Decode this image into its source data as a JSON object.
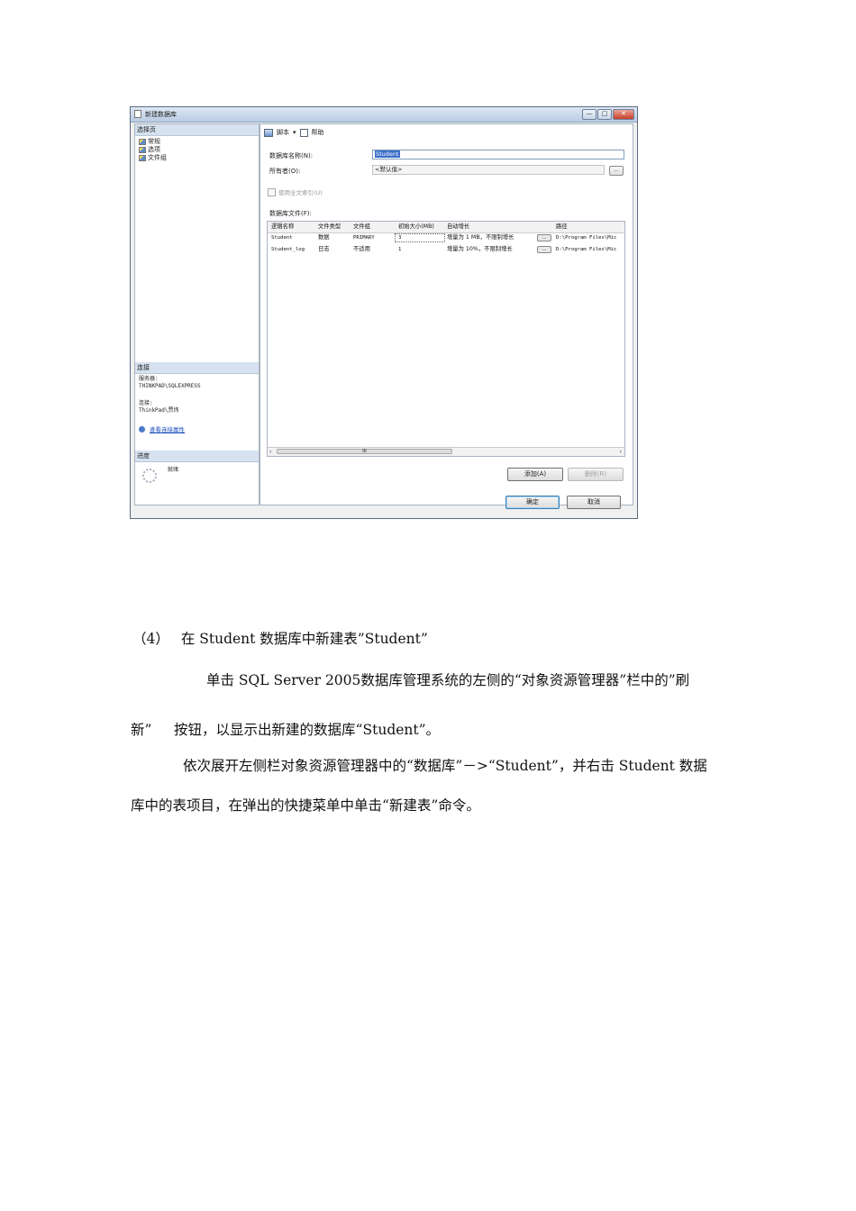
{
  "dialog": {
    "title": "新建数据库",
    "window_buttons": [
      "—",
      "□",
      "✕"
    ],
    "select_page_header": "选择页",
    "pages": [
      "常规",
      "选项",
      "文件组"
    ],
    "connection_header": "连接",
    "server_label": "服务器:",
    "server_value": "THINKPAD\\SQLEXPRESS",
    "connection_label": "连接:",
    "connection_value": "ThinkPad\\贾炜",
    "view_connection_props": "查看连接属性",
    "progress_header": "进度",
    "progress_status": "就绪",
    "toolbar": {
      "script": "脚本",
      "dropdown": "▾",
      "help": "帮助"
    },
    "db_name_label": "数据库名称(N):",
    "db_name_value": "Student",
    "owner_label": "所有者(O):",
    "owner_value": "<默认值>",
    "fulltext_label": "使用全文索引(U)",
    "db_files_label": "数据库文件(F):",
    "ellipsis": "...",
    "grid": {
      "columns": [
        "逻辑名称",
        "文件类型",
        "文件组",
        "初始大小(MB)",
        "自动增长",
        "路径"
      ],
      "rows": [
        [
          "Student",
          "数据",
          "PRIMARY",
          "3",
          "增量为 1 MB，不限制增长",
          "D:\\Program Files\\Mic"
        ],
        [
          "Student_log",
          "日志",
          "不适用",
          "1",
          "增量为 10%，不限制增长",
          "D:\\Program Files\\Mic"
        ]
      ],
      "scroll_thumb": "III"
    },
    "add_button": "添加(A)",
    "remove_button": "删除(R)",
    "ok_button": "确定",
    "cancel_button": "取消"
  },
  "doc": {
    "step_num": "（4）",
    "step_text": "在 Student 数据库中新建表”Student”",
    "para1_line1": "单击 SQL Server 2005数据库管理系统的左侧的“对象资源管理器”栏中的”刷",
    "para1_line2": "新”     按钮，以显示出新建的数据库“Student”。",
    "para2_line1": "依次展开左侧栏对象资源管理器中的“数据库”－>“Student”，并右击 Student 数据",
    "para2_line2": "库中的表项目，在弹出的快捷菜单中单击“新建表”命令。"
  }
}
